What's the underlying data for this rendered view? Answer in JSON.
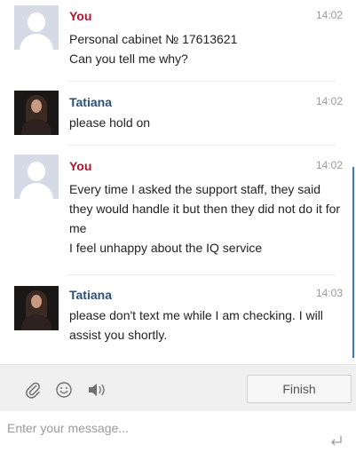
{
  "messages": [
    {
      "author": "You",
      "time": "14:02",
      "lines": [
        "Personal cabinet № 17613621",
        "Can you tell me why?"
      ]
    },
    {
      "author": "Tatiana",
      "time": "14:02",
      "lines": [
        "please hold on"
      ]
    },
    {
      "author": "You",
      "time": "14:02",
      "lines": [
        "Every time I asked the support staff, they said they would handle it but then they did not do it for me",
        "I feel unhappy about the IQ service"
      ]
    },
    {
      "author": "Tatiana",
      "time": "14:03",
      "lines": [
        "please don't text me while I am checking. I will assist you shortly."
      ]
    }
  ],
  "toolbar": {
    "icons": [
      "attachment-icon",
      "emoji-icon",
      "sound-icon"
    ],
    "finish_label": "Finish"
  },
  "input": {
    "placeholder": "Enter your message...",
    "value": ""
  },
  "colors": {
    "user_name": "#b3122c",
    "operator_name": "#2e4f7a",
    "timestamp": "#9a9a9a",
    "toolbar_bg": "#f0f0f0",
    "scrollbar": "#3b73c9"
  }
}
